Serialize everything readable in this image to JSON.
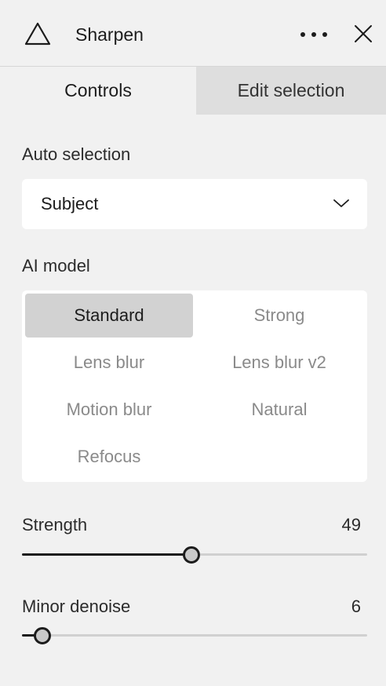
{
  "header": {
    "title": "Sharpen",
    "logo_icon": "triangle-icon",
    "more_icon": "more-horizontal-icon",
    "close_icon": "close-icon"
  },
  "tabs": [
    {
      "label": "Controls",
      "active": true
    },
    {
      "label": "Edit selection",
      "active": false
    }
  ],
  "auto_selection": {
    "label": "Auto selection",
    "value": "Subject"
  },
  "ai_model": {
    "label": "AI model",
    "options": [
      "Standard",
      "Strong",
      "Lens blur",
      "Lens blur v2",
      "Motion blur",
      "Natural",
      "Refocus"
    ],
    "selected": "Standard"
  },
  "sliders": {
    "strength": {
      "label": "Strength",
      "value": "49",
      "fraction": 0.49
    },
    "minor_denoise": {
      "label": "Minor denoise",
      "value": "6",
      "fraction": 0.06
    }
  },
  "colors": {
    "background": "#f1f1f1",
    "inactive_tab": "#dedede",
    "selected_model": "#d2d2d2",
    "slider_fill": "#1c1c1c",
    "slider_track": "#d0d0d0"
  }
}
